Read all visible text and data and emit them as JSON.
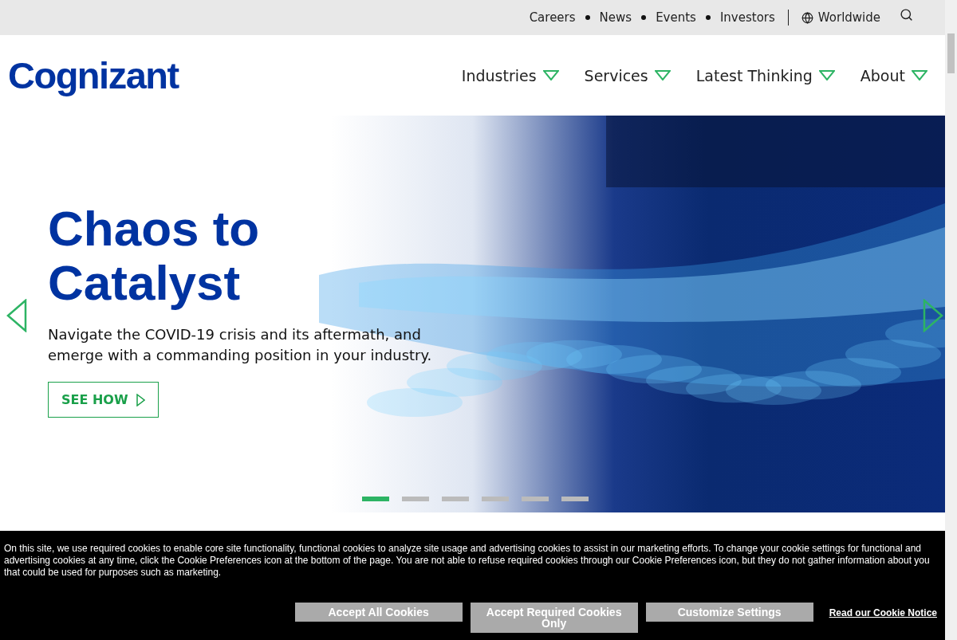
{
  "top_links": [
    {
      "label": "Careers"
    },
    {
      "label": "News"
    },
    {
      "label": "Events"
    },
    {
      "label": "Investors"
    }
  ],
  "region": "Worldwide",
  "logo": "Cognizant",
  "nav": [
    {
      "label": "Industries"
    },
    {
      "label": "Services"
    },
    {
      "label": "Latest Thinking"
    },
    {
      "label": "About"
    }
  ],
  "hero": {
    "title": "Chaos to Catalyst",
    "description": "Navigate the COVID-19 crisis and its aftermath, and emerge with a commanding position in your industry.",
    "cta": "SEE HOW",
    "slides": [
      {
        "selected": true
      },
      {
        "selected": false
      },
      {
        "selected": false
      },
      {
        "selected": false
      },
      {
        "selected": false
      },
      {
        "selected": false
      }
    ]
  },
  "cookie_banner": {
    "text": "On this site, we use required cookies to enable core site functionality, functional cookies to analyze site usage and advertising cookies to assist in our marketing efforts. To change your cookie settings for functional and advertising cookies at any time, click the Cookie Preferences icon at the bottom of the page. You are not able to refuse required cookies through our Cookie Preferences icon, but they do not gather information about you that could be used for purposes such as marketing.",
    "buttons": [
      "Accept All Cookies",
      "Accept Required Cookies Only",
      "Customize Settings"
    ],
    "link": "Read our Cookie Notice"
  }
}
